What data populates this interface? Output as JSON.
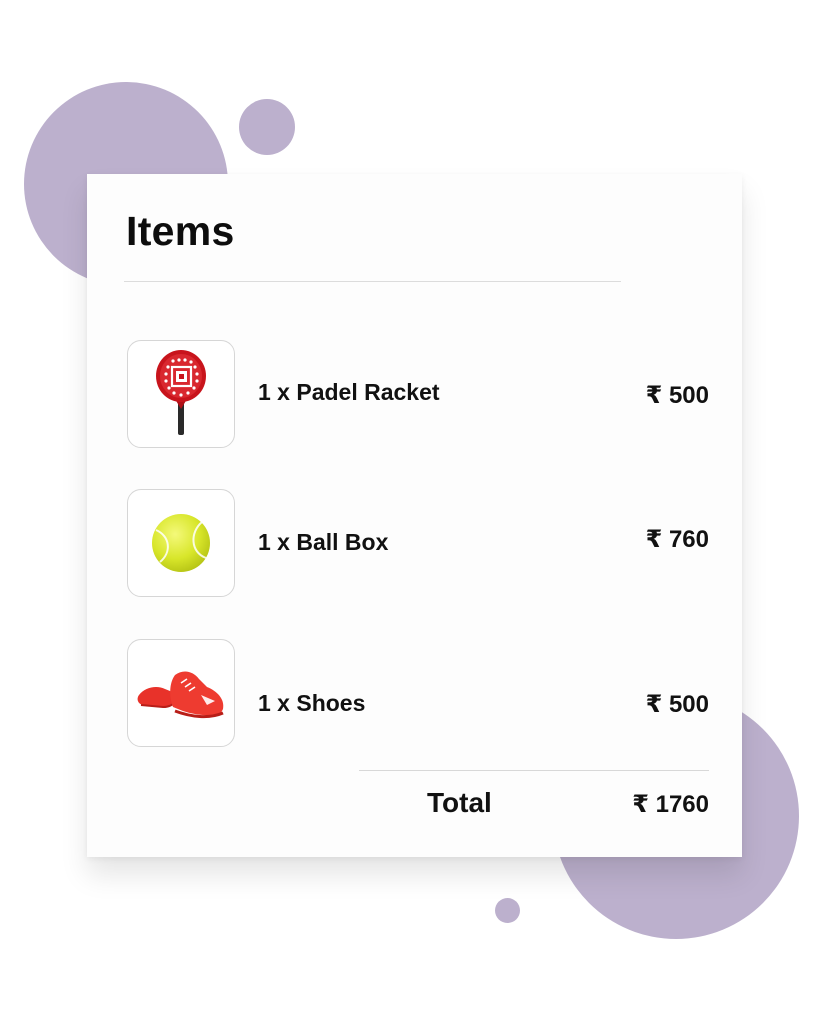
{
  "card": {
    "title": "Items"
  },
  "items": [
    {
      "name": "1 x Padel Racket",
      "price": "₹ 500",
      "icon": "padel-racket-image"
    },
    {
      "name": "1 x Ball Box",
      "price": "₹ 760",
      "icon": "tennis-ball-image"
    },
    {
      "name": "1 x Shoes",
      "price": "₹ 500",
      "icon": "shoes-image"
    }
  ],
  "total": {
    "label": "Total",
    "value": "₹ 1760"
  },
  "colors": {
    "background_blob": "#bcb0cd",
    "card": "#fdfdfd",
    "text": "#111111"
  }
}
